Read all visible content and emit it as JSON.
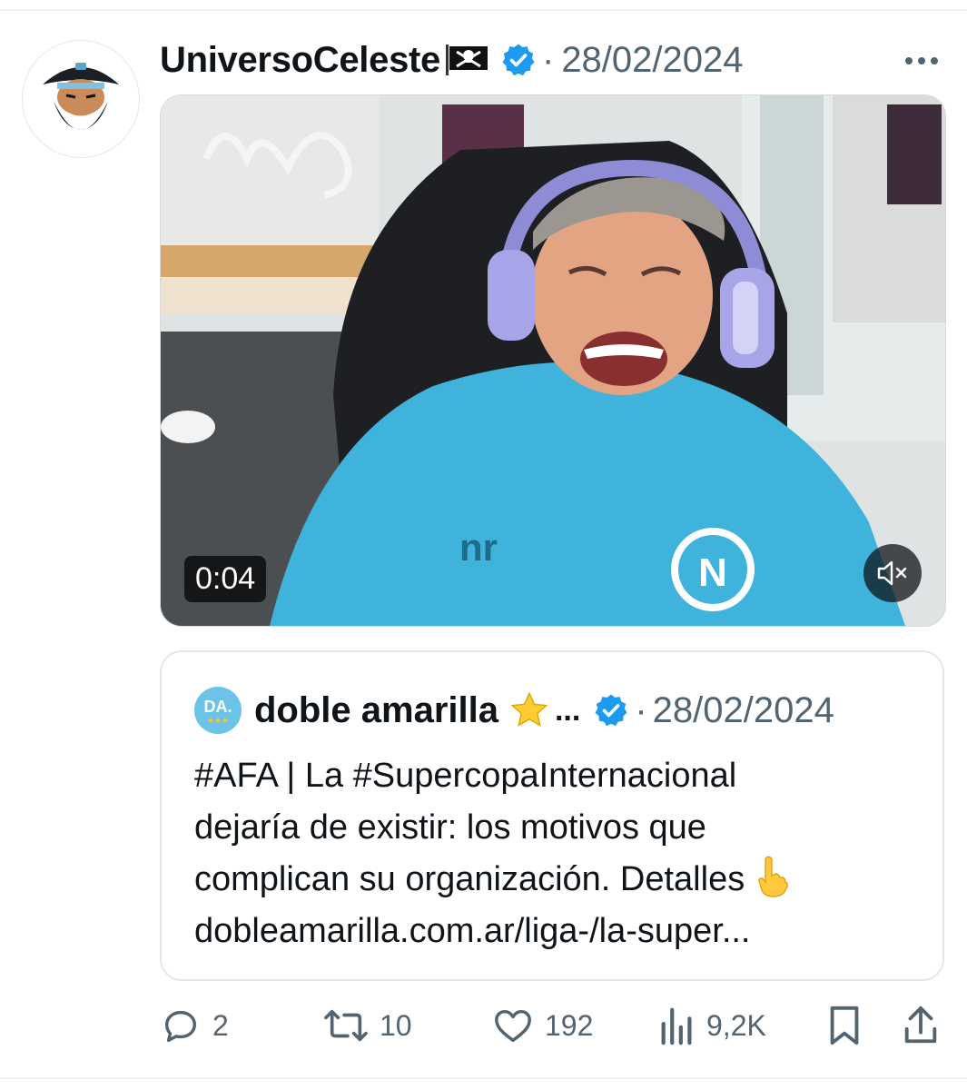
{
  "tweet": {
    "author_name": "UniversoCeleste",
    "author_flag_icon": "pirate-flag-icon",
    "verified": true,
    "date": "28/02/2024",
    "separator": "·",
    "media": {
      "type": "video",
      "duration": "0:04",
      "muted": true
    }
  },
  "quoted_tweet": {
    "author_name": "doble amarilla",
    "avatar_text": "DA.",
    "avatar_stars": "★★★",
    "name_emoji": "star-emoji",
    "ellipsis": "...",
    "verified": true,
    "separator": "·",
    "date": "28/02/2024",
    "text_lines": [
      "#AFA | La #SupercopaInternacional",
      "dejaría de existir: los motivos que",
      "complican su organización. Detalles",
      "dobleamarilla.com.ar/liga-/la-super..."
    ]
  },
  "actions": {
    "replies": "2",
    "retweets": "10",
    "likes": "192",
    "views": "9,2K"
  },
  "colors": {
    "text": "#0f1419",
    "secondary": "#536471",
    "verified": "#1d9bf0",
    "border": "#e1e8ed"
  }
}
